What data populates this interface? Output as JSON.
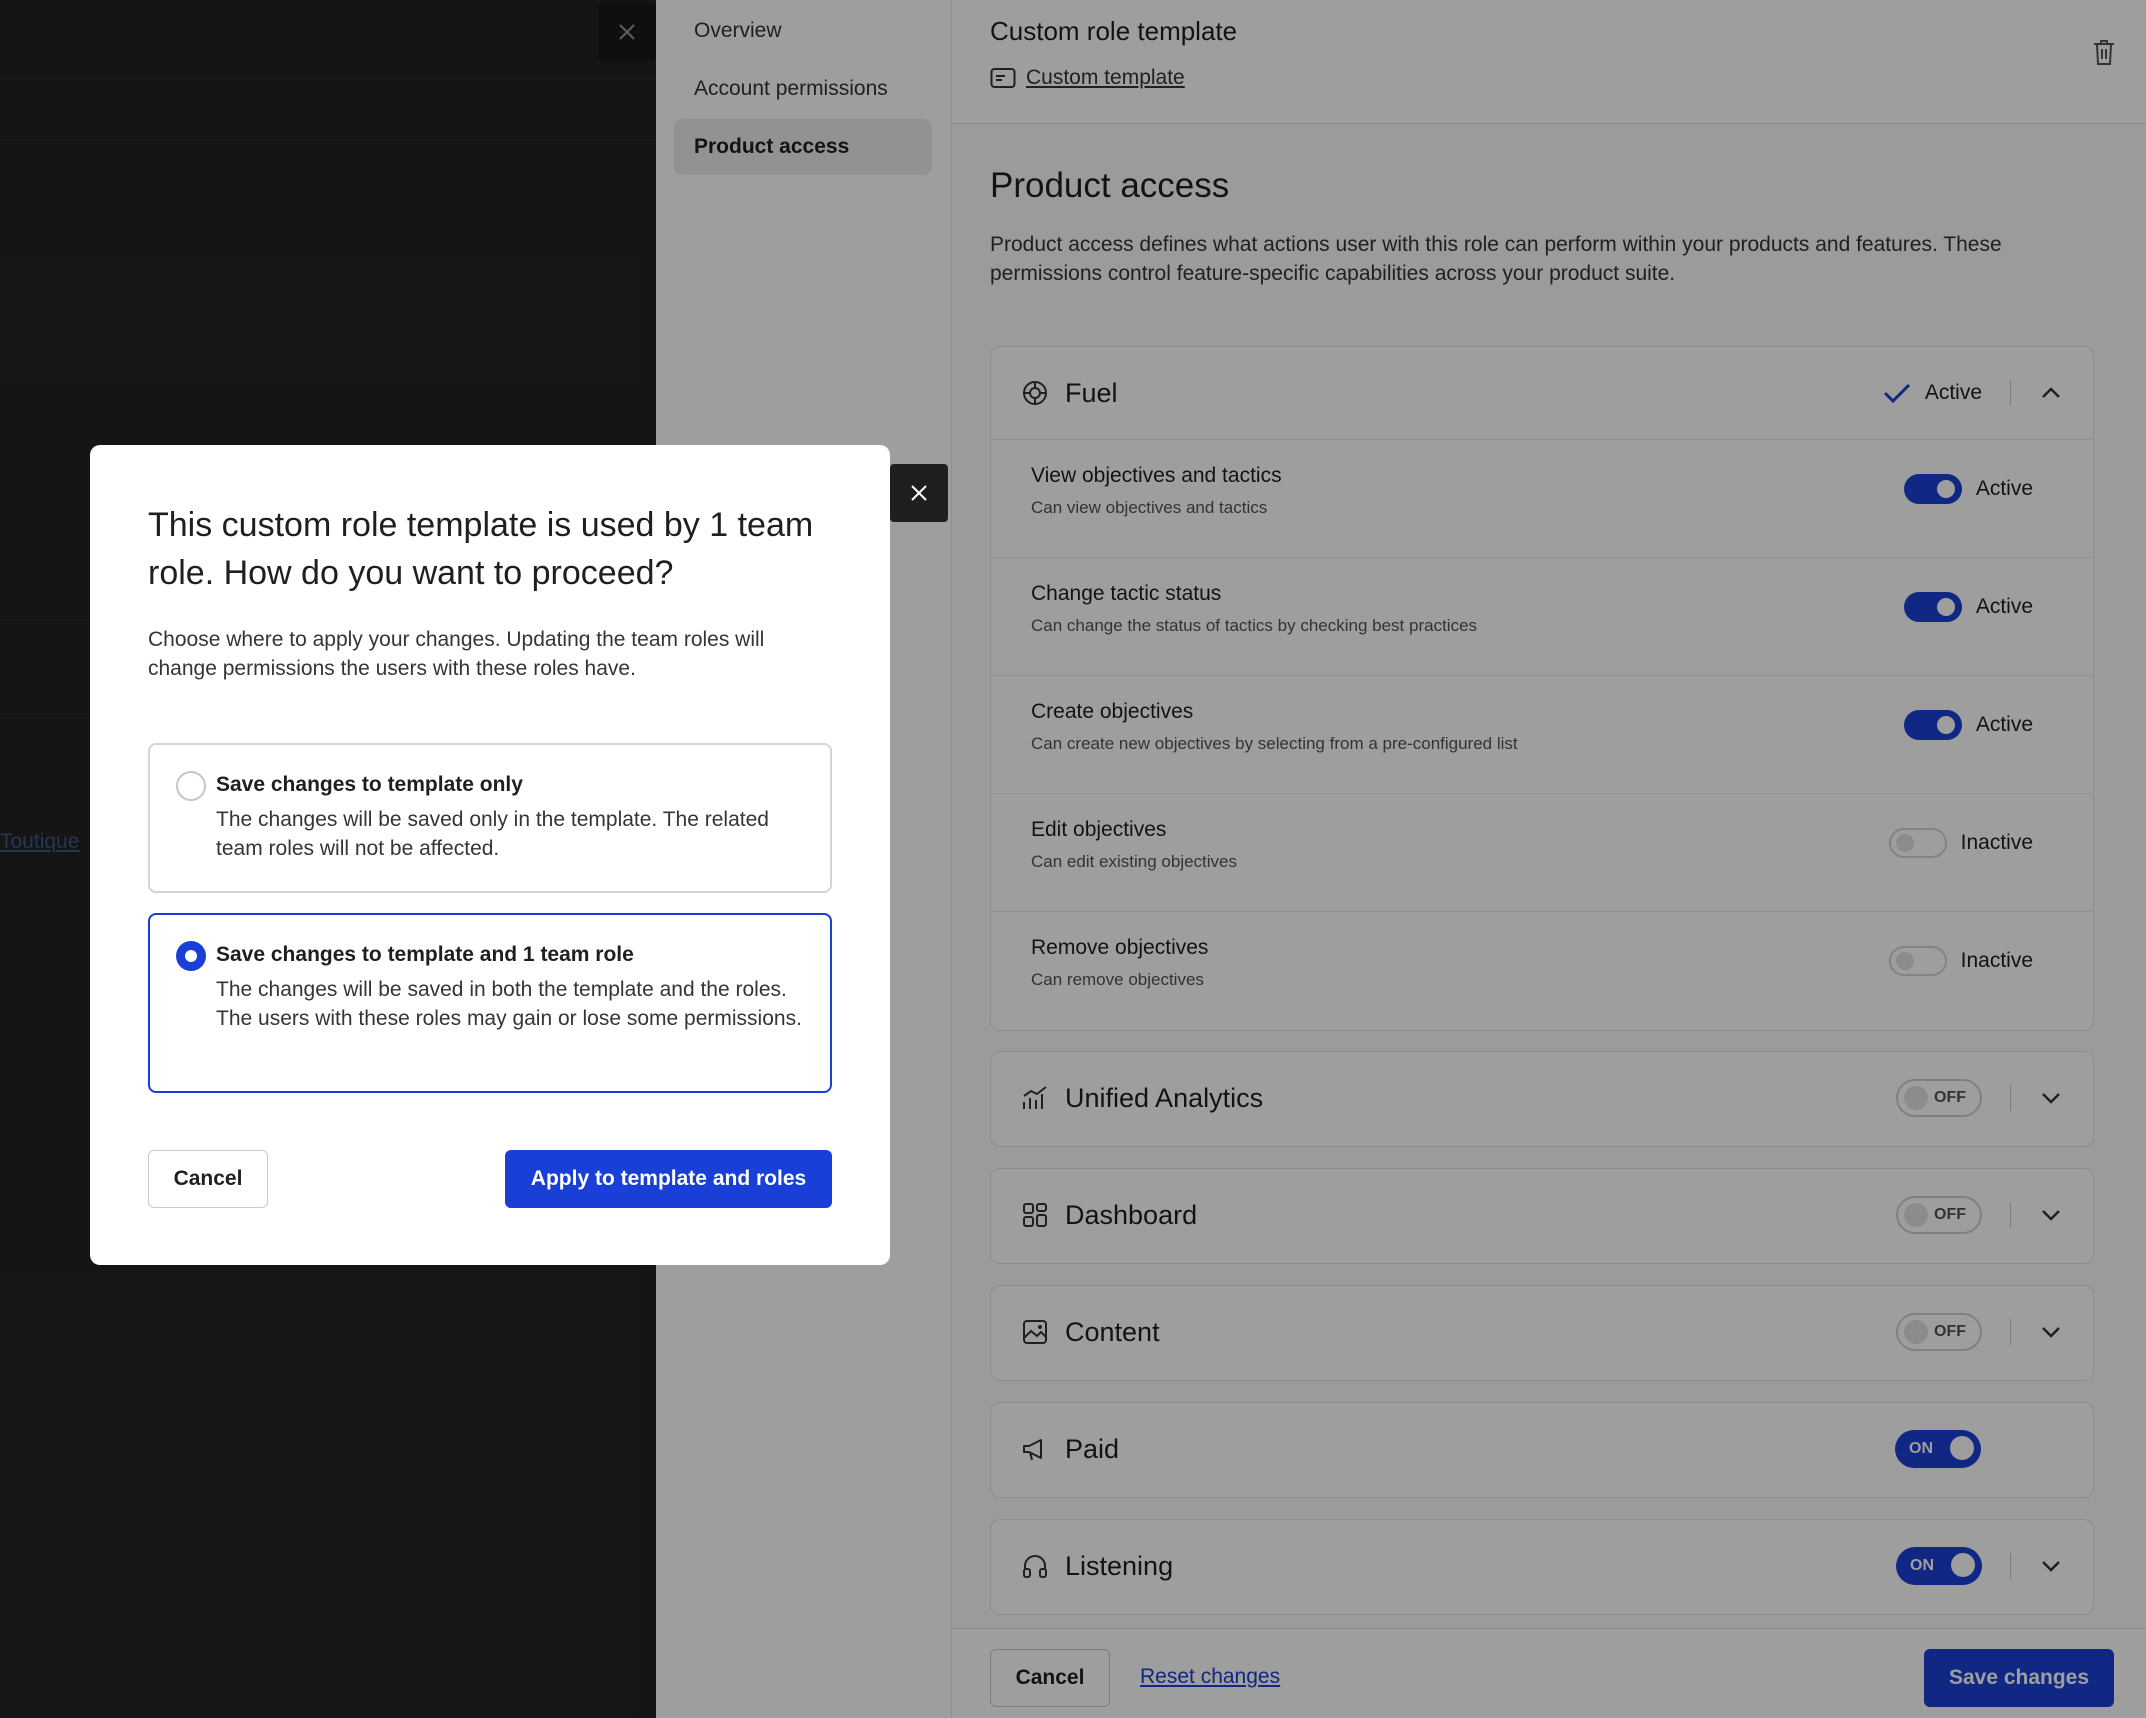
{
  "background": {
    "partial_link": "Toutique"
  },
  "nav": {
    "items": [
      {
        "label": "Overview"
      },
      {
        "label": "Account permissions"
      },
      {
        "label": "Product access"
      }
    ]
  },
  "header": {
    "title": "Custom role template",
    "template_link": "Custom template"
  },
  "section": {
    "title": "Product access",
    "description": "Product access defines what actions user with this role can perform within your products and features. These permissions control feature-specific capabilities across your product suite."
  },
  "products": {
    "fuel": {
      "name": "Fuel",
      "status": "Active",
      "permissions": [
        {
          "title": "View objectives and tactics",
          "desc": "Can view objectives and tactics",
          "state": "Active"
        },
        {
          "title": "Change tactic status",
          "desc": "Can change the status of tactics by checking best practices",
          "state": "Active"
        },
        {
          "title": "Create objectives",
          "desc": "Can create new objectives by selecting from a pre-configured list",
          "state": "Active"
        },
        {
          "title": "Edit objectives",
          "desc": "Can edit existing objectives",
          "state": "Inactive"
        },
        {
          "title": "Remove objectives",
          "desc": "Can remove objectives",
          "state": "Inactive"
        }
      ]
    },
    "others": [
      {
        "name": "Unified Analytics",
        "toggle": "OFF"
      },
      {
        "name": "Dashboard",
        "toggle": "OFF"
      },
      {
        "name": "Content",
        "toggle": "OFF"
      },
      {
        "name": "Paid",
        "toggle": "ON"
      },
      {
        "name": "Listening",
        "toggle": "ON"
      }
    ]
  },
  "footer": {
    "cancel": "Cancel",
    "reset": "Reset changes",
    "save": "Save changes"
  },
  "dialog": {
    "title": "This custom role template is used by 1 team role. How do you want to proceed?",
    "description": "Choose where to apply your changes. Updating the team roles will change permissions the users with these roles have.",
    "options": [
      {
        "title": "Save changes to template only",
        "desc": "The changes will be saved only in the template. The related team roles will not be affected."
      },
      {
        "title": "Save changes to template and 1 team role",
        "desc": "The changes will be saved in both the template and the roles. The users with these roles may gain or lose some permissions."
      }
    ],
    "selected_option": 1,
    "cancel": "Cancel",
    "apply": "Apply to template and roles"
  },
  "colors": {
    "accent": "#1a3fd6",
    "overlay": "#000000"
  }
}
